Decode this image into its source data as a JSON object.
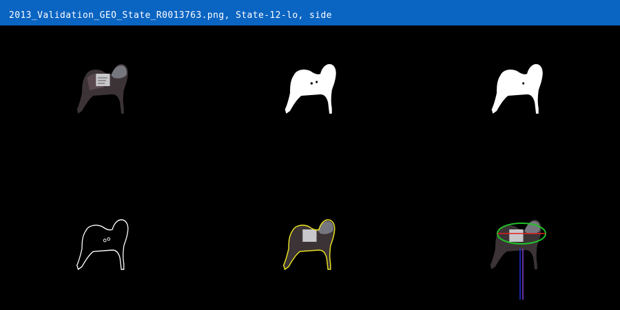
{
  "window": {
    "title": "2013_Validation_GEO_State_R0013763.png, State-12-lo, side"
  },
  "panels": [
    {
      "id": "original",
      "content": "original-photo"
    },
    {
      "id": "mask",
      "content": "binary-mask"
    },
    {
      "id": "mask-filled",
      "content": "filled-binary-mask"
    },
    {
      "id": "contour",
      "content": "white-contour"
    },
    {
      "id": "overlay",
      "content": "yellow-contour-overlay"
    },
    {
      "id": "fit",
      "content": "ellipse-fit-overlay"
    }
  ],
  "colors": {
    "titlebar": "#0a64c2",
    "background": "#000000",
    "animal": "#3a3234",
    "mask": "#ffffff",
    "contour_white": "#ffffff",
    "contour_yellow": "#e8e020",
    "ellipse": "#22c32a",
    "major_axis": "#e02020",
    "minor_axis": "#2030e0",
    "axis_mark": "#8040d0"
  }
}
